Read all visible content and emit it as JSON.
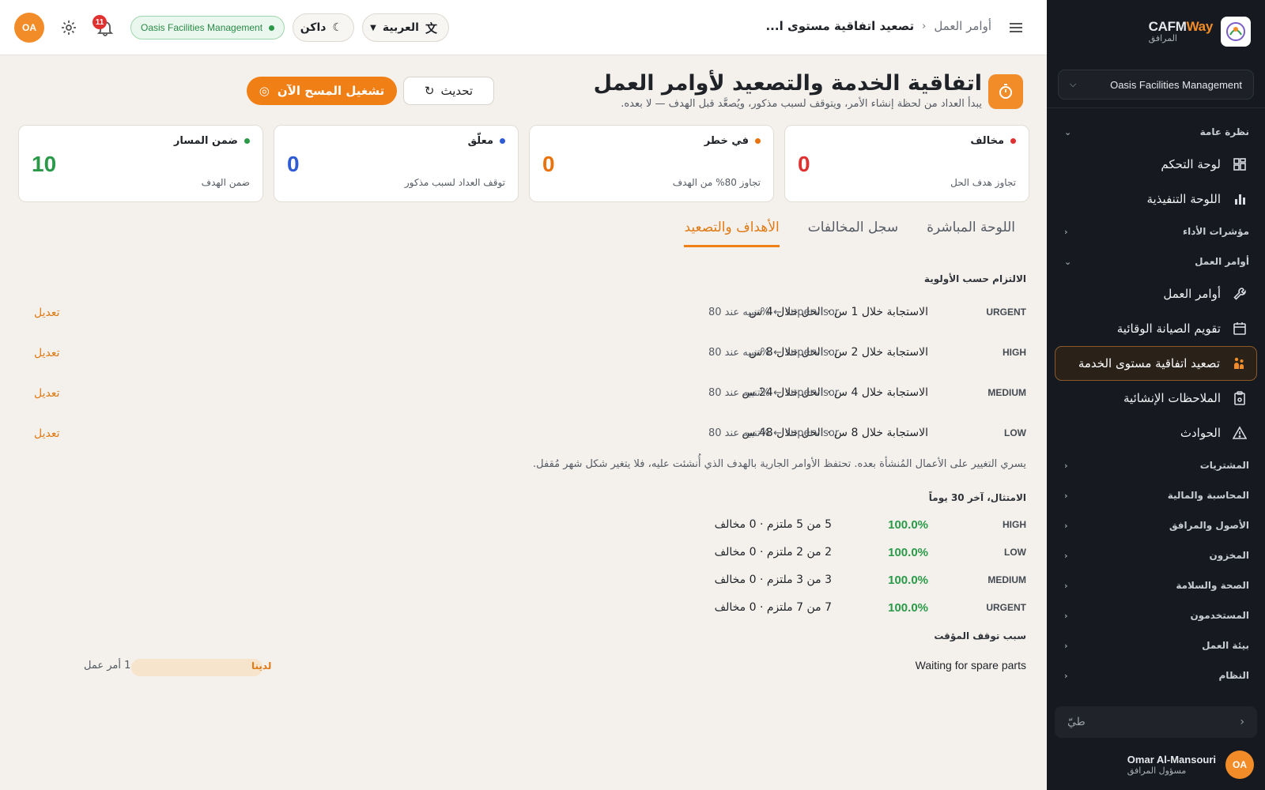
{
  "sidebar": {
    "brand_name_a": "CAFM",
    "brand_name_b": "Way",
    "brand_sub": "المرافق",
    "org_select": "Oasis Facilities Management",
    "groups": {
      "overview": "نظرة عامة",
      "kpi": "مؤشرات الأداء",
      "work_orders": "أوامر العمل",
      "procurement": "المشتريات",
      "finance": "المحاسبة والمالية",
      "assets": "الأصول والمرافق",
      "inventory": "المخزون",
      "hse": "الصحة والسلامة",
      "users": "المستخدمون",
      "work_env": "بيئة العمل",
      "system": "النظام"
    },
    "items": {
      "dashboard": "لوحة التحكم",
      "executive": "اللوحة التنفيذية",
      "work_orders": "أوامر العمل",
      "pm_calendar": "تقويم الصيانة الوقائية",
      "sla": "تصعيد اتفاقية مستوى الخدمة",
      "structural": "الملاحظات الإنشائية",
      "incidents": "الحوادث"
    },
    "collapse_label": "طيّ",
    "user_name": "Omar Al-Mansouri",
    "user_role": "مسؤول المرافق",
    "user_initials": "OA"
  },
  "topbar": {
    "breadcrumb_parent": "أوامر العمل",
    "breadcrumb_current": "تصعيد اتفاقية مستوى ا...",
    "language": "العربية",
    "theme": "داكن",
    "org_badge": "Oasis Facilities Management",
    "notifications": "11",
    "avatar": "OA"
  },
  "page": {
    "title": "اتفاقية الخدمة والتصعيد لأوامر العمل",
    "subtitle": "يبدأ العداد من لحظة إنشاء الأمر، ويتوقف لسبب مذكور، ويُصعَّد قبل الهدف — لا بعده.",
    "refresh": "تحديث",
    "run_scan": "تشغيل المسح الآن"
  },
  "cards": [
    {
      "label": "مخالف",
      "value": "0",
      "desc": "تجاوز هدف الحل",
      "color": "#e03131"
    },
    {
      "label": "في خطر",
      "value": "0",
      "desc": "تجاوز 80% من الهدف",
      "color": "#e8720c"
    },
    {
      "label": "معلّق",
      "value": "0",
      "desc": "توقف العداد لسبب مذكور",
      "color": "#2f5bd3"
    },
    {
      "label": "ضمن المسار",
      "value": "10",
      "desc": "ضمن الهدف",
      "color": "#2a9a48"
    }
  ],
  "tabs": {
    "live": "اللوحة المباشرة",
    "breaches": "سجل المخالفات",
    "targets": "الأهداف والتصعيد"
  },
  "targets": {
    "section_title": "الالتزام حسب الأولوية",
    "edit": "تعديل",
    "rows": [
      {
        "priority": "URGENT",
        "text": "الاستجابة خلال 1 س · الحل خلال 4 س",
        "alert": "تنبيه عند 80% ← supervisor"
      },
      {
        "priority": "HIGH",
        "text": "الاستجابة خلال 2 س · الحل خلال 8 س",
        "alert": "تنبيه عند 80% ← supervisor"
      },
      {
        "priority": "MEDIUM",
        "text": "الاستجابة خلال 4 س · الحل خلال 24 س",
        "alert": "تنبيه عند 80% ← supervisor"
      },
      {
        "priority": "LOW",
        "text": "الاستجابة خلال 8 س · الحل خلال 48 س",
        "alert": "تنبيه عند 80% ← supervisor"
      }
    ],
    "note": "يسري التغيير على الأعمال المُنشأة بعده. تحتفظ الأوامر الجارية بالهدف الذي أُنشئت عليه، فلا يتغير شكل شهر مُقفل."
  },
  "compliance": {
    "section_title": "الامتثال، آخر 30 يوماً",
    "rows": [
      {
        "priority": "HIGH",
        "pct": "100.0%",
        "detail": "5 من 5 ملتزم · 0 مخالف"
      },
      {
        "priority": "LOW",
        "pct": "100.0%",
        "detail": "2 من 2 ملتزم · 0 مخالف"
      },
      {
        "priority": "MEDIUM",
        "pct": "100.0%",
        "detail": "3 من 3 ملتزم · 0 مخالف"
      },
      {
        "priority": "URGENT",
        "pct": "100.0%",
        "detail": "7 من 7 ملتزم · 0 مخالف"
      }
    ]
  },
  "pause_causes": {
    "section_title": "سبب توقف المؤقت",
    "rows": [
      {
        "name": "Waiting for spare parts",
        "tag": "لدينا",
        "count": "1 أمر عمل",
        "share": 1.0
      }
    ]
  },
  "colors": {
    "accent": "#f07f16",
    "sidebar_bg": "#16191f",
    "success": "#2a9a48"
  }
}
